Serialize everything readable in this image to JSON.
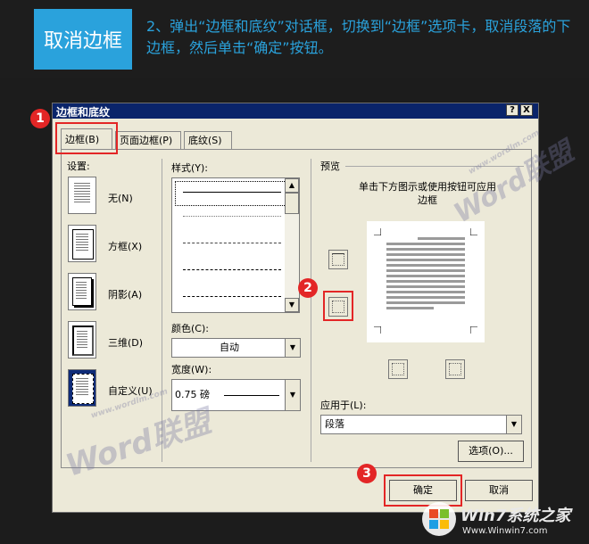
{
  "header": {
    "badge": "取消边框",
    "instruction": "2、弹出“边框和底纹”对话框，切换到“边框”选项卡，取消段落的下边框，然后单击“确定”按钮。"
  },
  "dialog": {
    "title": "边框和底纹",
    "help_btn": "?",
    "close_btn": "X",
    "tabs": [
      "边框(B)",
      "页面边框(P)",
      "底纹(S)"
    ],
    "settings": {
      "label": "设置:",
      "items": [
        "无(N)",
        "方框(X)",
        "阴影(A)",
        "三维(D)",
        "自定义(U)"
      ]
    },
    "style": {
      "label": "样式(Y):"
    },
    "color": {
      "label": "颜色(C):",
      "value": "自动"
    },
    "width": {
      "label": "宽度(W):",
      "value": "0.75 磅"
    },
    "preview": {
      "label": "预览",
      "hint": "单击下方图示或使用按钮可应用边框"
    },
    "apply_to": {
      "label": "应用于(L):",
      "value": "段落"
    },
    "options_btn": "选项(O)...",
    "ok_btn": "确定",
    "cancel_btn": "取消"
  },
  "steps": [
    "1",
    "2",
    "3"
  ],
  "watermarks": [
    "Word联盟",
    "www.wordlm.com"
  ],
  "logo": {
    "brand": "Win7系统之家",
    "url": "Www.Winwin7.com"
  },
  "colors": {
    "accent": "#2aa2dc",
    "highlight": "#e32626",
    "title_bar": "#0a246a"
  }
}
